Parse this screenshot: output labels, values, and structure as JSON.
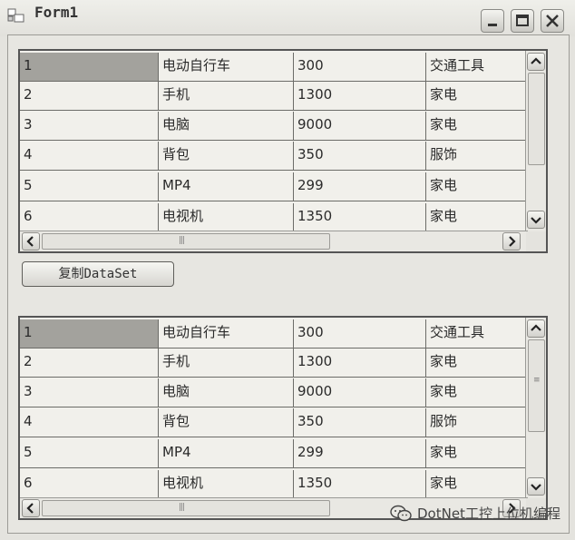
{
  "window": {
    "title": "Form1"
  },
  "grids": [
    {
      "rows": [
        [
          "1",
          "电动自行车",
          "300",
          "交通工具"
        ],
        [
          "2",
          "手机",
          "1300",
          "家电"
        ],
        [
          "3",
          "电脑",
          "9000",
          "家电"
        ],
        [
          "4",
          "背包",
          "350",
          "服饰"
        ],
        [
          "5",
          "MP4",
          "299",
          "家电"
        ],
        [
          "6",
          "电视机",
          "1350",
          "家电"
        ]
      ]
    },
    {
      "rows": [
        [
          "1",
          "电动自行车",
          "300",
          "交通工具"
        ],
        [
          "2",
          "手机",
          "1300",
          "家电"
        ],
        [
          "3",
          "电脑",
          "9000",
          "家电"
        ],
        [
          "4",
          "背包",
          "350",
          "服饰"
        ],
        [
          "5",
          "MP4",
          "299",
          "家电"
        ],
        [
          "6",
          "电视机",
          "1350",
          "家电"
        ]
      ]
    }
  ],
  "copy_button": {
    "label": "复制DataSet"
  },
  "watermark": {
    "text": "DotNet工控上位机编程"
  },
  "colors": {
    "selected_cell": "#a3a29d",
    "grid_border": "#555555"
  }
}
